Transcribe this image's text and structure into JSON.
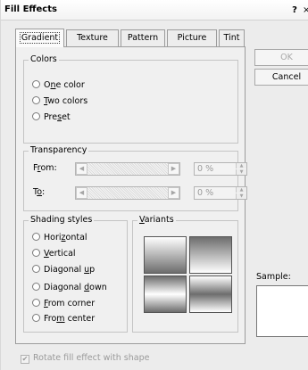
{
  "window": {
    "title": "Fill Effects",
    "help_label": "?",
    "close_label": "×"
  },
  "tabs": [
    {
      "label": "Gradient",
      "active": true
    },
    {
      "label": "Texture"
    },
    {
      "label": "Pattern"
    },
    {
      "label": "Picture"
    },
    {
      "label": "Tint"
    }
  ],
  "colors": {
    "label": "Colors",
    "options": [
      {
        "mnemonic": "n",
        "pre": "O",
        "post": "e color"
      },
      {
        "mnemonic": "T",
        "pre": "",
        "post": "wo colors"
      },
      {
        "mnemonic": "s",
        "pre": "Pre",
        "post": "et"
      }
    ]
  },
  "transparency": {
    "label": "Transparency",
    "from": {
      "mnemonic": "r",
      "pre": "F",
      "post": "om:",
      "value": "0 %",
      "level": 0
    },
    "to": {
      "mnemonic": "o",
      "pre": "T",
      "post": ":",
      "value": "0 %",
      "level": 0
    }
  },
  "shading": {
    "label": "Shading styles",
    "options": [
      {
        "pre": "Hori",
        "mnemonic": "z",
        "post": "ontal"
      },
      {
        "pre": "",
        "mnemonic": "V",
        "post": "ertical"
      },
      {
        "pre": "Diagonal ",
        "mnemonic": "u",
        "post": "p"
      },
      {
        "pre": "Diagonal ",
        "mnemonic": "d",
        "post": "own"
      },
      {
        "pre": "",
        "mnemonic": "F",
        "post": "rom corner"
      },
      {
        "pre": "Fro",
        "mnemonic": "m",
        "post": " center"
      }
    ]
  },
  "variants": {
    "pre": "",
    "mnemonic": "V",
    "post": "ariants"
  },
  "buttons": {
    "ok": "OK",
    "cancel": "Cancel"
  },
  "sample": {
    "label": "Sample:"
  },
  "rotate": {
    "label": "Rotate fill effect with shape",
    "checked": true,
    "enabled": false
  },
  "colors_theme": {
    "dialog_bg": "#ececec",
    "disabled_text": "#a8a8a8"
  }
}
